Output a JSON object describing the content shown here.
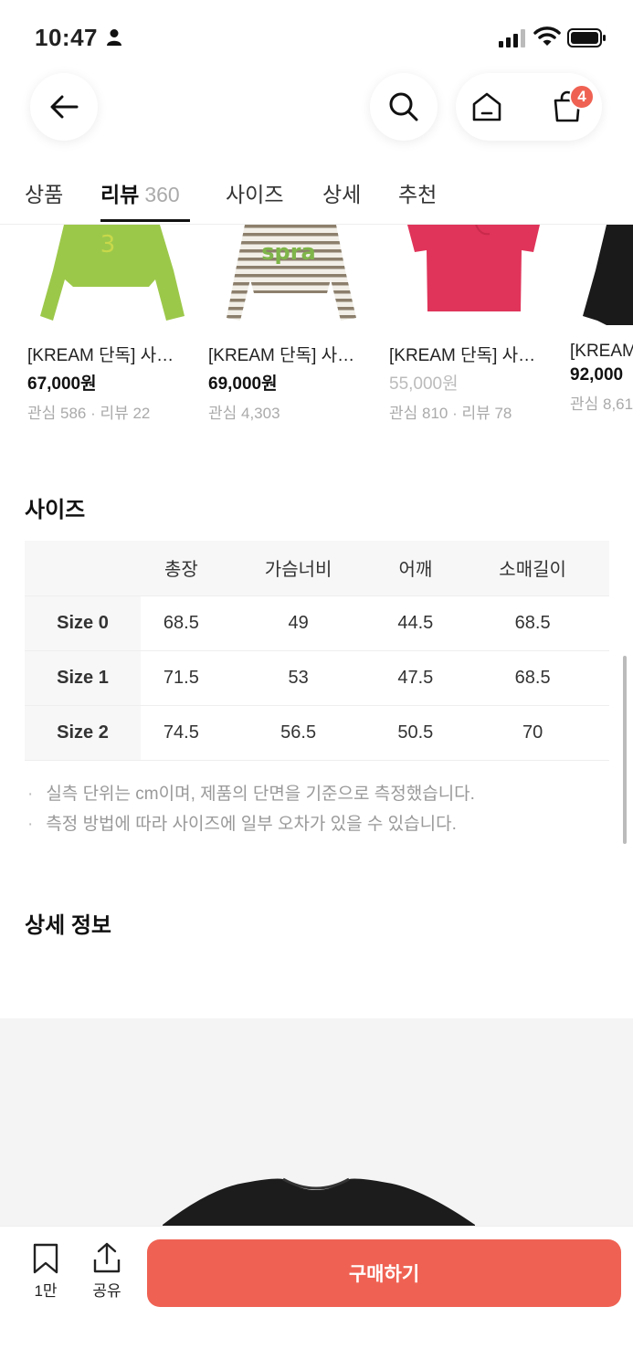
{
  "status_bar": {
    "time": "10:47"
  },
  "header": {
    "cart_badge": "4"
  },
  "tabs": [
    {
      "label": "상품"
    },
    {
      "label": "리뷰",
      "count": "360"
    },
    {
      "label": "사이즈"
    },
    {
      "label": "상세"
    },
    {
      "label": "추천"
    }
  ],
  "products": [
    {
      "name": "[KREAM 단독] 사…",
      "price": "67,000원",
      "meta": "관심 586 · 리뷰 22",
      "color": "#9cc84a"
    },
    {
      "name": "[KREAM 단독] 사…",
      "price": "69,000원",
      "meta": "관심 4,303",
      "color": "#8c7f6c"
    },
    {
      "name": "[KREAM 단독] 사…",
      "price": "55,000원",
      "meta": "관심 810 · 리뷰 78",
      "color": "#e0345a"
    },
    {
      "name": "[KREAM",
      "price": "92,000",
      "meta": "관심 8,61",
      "color": "#1a1a1a"
    }
  ],
  "size_section": {
    "title": "사이즈",
    "columns": [
      "",
      "총장",
      "가슴너비",
      "어깨",
      "소매길이"
    ],
    "rows": [
      {
        "label": "Size 0",
        "values": [
          "68.5",
          "49",
          "44.5",
          "68.5"
        ]
      },
      {
        "label": "Size 1",
        "values": [
          "71.5",
          "53",
          "47.5",
          "68.5"
        ]
      },
      {
        "label": "Size 2",
        "values": [
          "74.5",
          "56.5",
          "50.5",
          "70"
        ]
      }
    ],
    "notes": [
      "실측 단위는 cm이며, 제품의 단면을 기준으로 측정했습니다.",
      "측정 방법에 따라 사이즈에 일부 오차가 있을 수 있습니다."
    ]
  },
  "detail_section": {
    "title": "상세 정보"
  },
  "bottom_bar": {
    "save_count": "1만",
    "share_label": "공유",
    "buy_label": "구매하기",
    "accent": "#ef6253"
  }
}
